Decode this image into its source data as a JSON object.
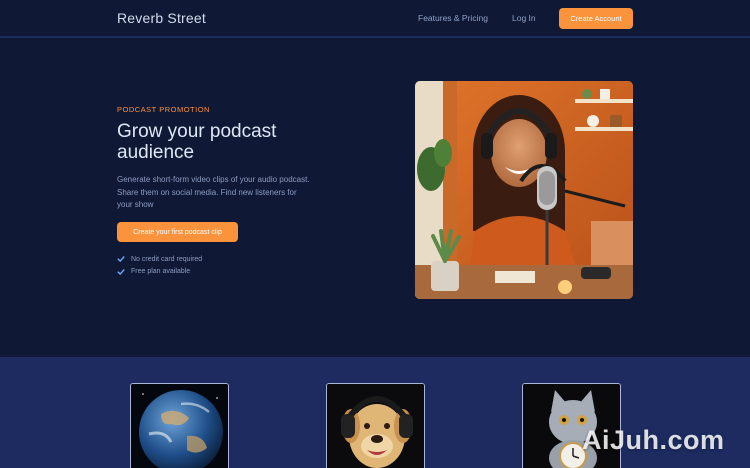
{
  "header": {
    "brand": "Reverb Street",
    "nav_features": "Features & Pricing",
    "nav_login": "Log In",
    "create_account": "Create Account"
  },
  "hero": {
    "eyebrow": "PODCAST PROMOTION",
    "title": "Grow your podcast audience",
    "description": "Generate short-form video clips of your audio podcast. Share them on social media. Find new listeners for your show",
    "cta": "Create your first podcast clip",
    "checks": [
      "No credit card required",
      "Free plan available"
    ],
    "image_icon": "podcaster-photo"
  },
  "features": {
    "cards": [
      {
        "icon": "earth-photo"
      },
      {
        "icon": "dog-headphones-photo"
      },
      {
        "icon": "cat-clock-photo"
      }
    ]
  },
  "watermark": "AiJuh.com",
  "colors": {
    "background": "#0f1935",
    "accent": "#fb923c",
    "band": "#1d2b61"
  }
}
